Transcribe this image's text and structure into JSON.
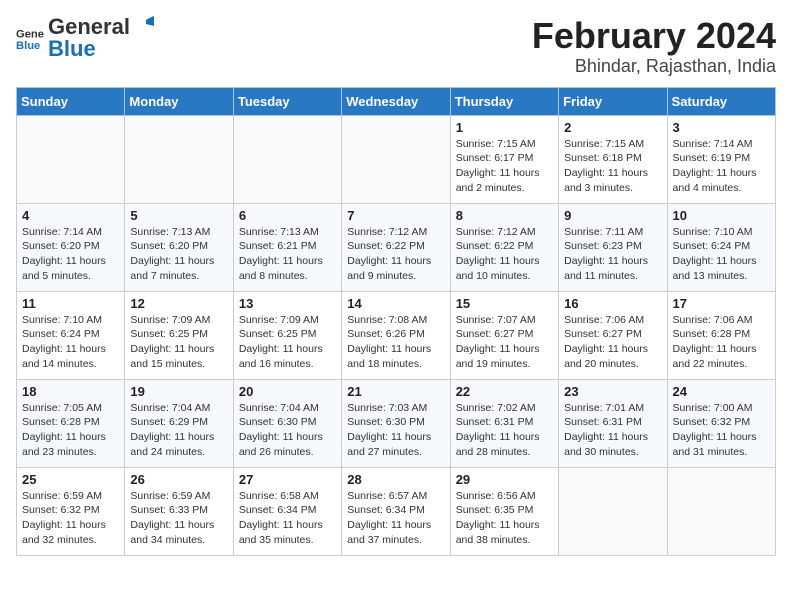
{
  "logo": {
    "text_general": "General",
    "text_blue": "Blue"
  },
  "title": "February 2024",
  "subtitle": "Bhindar, Rajasthan, India",
  "days_of_week": [
    "Sunday",
    "Monday",
    "Tuesday",
    "Wednesday",
    "Thursday",
    "Friday",
    "Saturday"
  ],
  "weeks": [
    [
      {
        "day": "",
        "info": ""
      },
      {
        "day": "",
        "info": ""
      },
      {
        "day": "",
        "info": ""
      },
      {
        "day": "",
        "info": ""
      },
      {
        "day": "1",
        "info": "Sunrise: 7:15 AM\nSunset: 6:17 PM\nDaylight: 11 hours and 2 minutes."
      },
      {
        "day": "2",
        "info": "Sunrise: 7:15 AM\nSunset: 6:18 PM\nDaylight: 11 hours and 3 minutes."
      },
      {
        "day": "3",
        "info": "Sunrise: 7:14 AM\nSunset: 6:19 PM\nDaylight: 11 hours and 4 minutes."
      }
    ],
    [
      {
        "day": "4",
        "info": "Sunrise: 7:14 AM\nSunset: 6:20 PM\nDaylight: 11 hours and 5 minutes."
      },
      {
        "day": "5",
        "info": "Sunrise: 7:13 AM\nSunset: 6:20 PM\nDaylight: 11 hours and 7 minutes."
      },
      {
        "day": "6",
        "info": "Sunrise: 7:13 AM\nSunset: 6:21 PM\nDaylight: 11 hours and 8 minutes."
      },
      {
        "day": "7",
        "info": "Sunrise: 7:12 AM\nSunset: 6:22 PM\nDaylight: 11 hours and 9 minutes."
      },
      {
        "day": "8",
        "info": "Sunrise: 7:12 AM\nSunset: 6:22 PM\nDaylight: 11 hours and 10 minutes."
      },
      {
        "day": "9",
        "info": "Sunrise: 7:11 AM\nSunset: 6:23 PM\nDaylight: 11 hours and 11 minutes."
      },
      {
        "day": "10",
        "info": "Sunrise: 7:10 AM\nSunset: 6:24 PM\nDaylight: 11 hours and 13 minutes."
      }
    ],
    [
      {
        "day": "11",
        "info": "Sunrise: 7:10 AM\nSunset: 6:24 PM\nDaylight: 11 hours and 14 minutes."
      },
      {
        "day": "12",
        "info": "Sunrise: 7:09 AM\nSunset: 6:25 PM\nDaylight: 11 hours and 15 minutes."
      },
      {
        "day": "13",
        "info": "Sunrise: 7:09 AM\nSunset: 6:25 PM\nDaylight: 11 hours and 16 minutes."
      },
      {
        "day": "14",
        "info": "Sunrise: 7:08 AM\nSunset: 6:26 PM\nDaylight: 11 hours and 18 minutes."
      },
      {
        "day": "15",
        "info": "Sunrise: 7:07 AM\nSunset: 6:27 PM\nDaylight: 11 hours and 19 minutes."
      },
      {
        "day": "16",
        "info": "Sunrise: 7:06 AM\nSunset: 6:27 PM\nDaylight: 11 hours and 20 minutes."
      },
      {
        "day": "17",
        "info": "Sunrise: 7:06 AM\nSunset: 6:28 PM\nDaylight: 11 hours and 22 minutes."
      }
    ],
    [
      {
        "day": "18",
        "info": "Sunrise: 7:05 AM\nSunset: 6:28 PM\nDaylight: 11 hours and 23 minutes."
      },
      {
        "day": "19",
        "info": "Sunrise: 7:04 AM\nSunset: 6:29 PM\nDaylight: 11 hours and 24 minutes."
      },
      {
        "day": "20",
        "info": "Sunrise: 7:04 AM\nSunset: 6:30 PM\nDaylight: 11 hours and 26 minutes."
      },
      {
        "day": "21",
        "info": "Sunrise: 7:03 AM\nSunset: 6:30 PM\nDaylight: 11 hours and 27 minutes."
      },
      {
        "day": "22",
        "info": "Sunrise: 7:02 AM\nSunset: 6:31 PM\nDaylight: 11 hours and 28 minutes."
      },
      {
        "day": "23",
        "info": "Sunrise: 7:01 AM\nSunset: 6:31 PM\nDaylight: 11 hours and 30 minutes."
      },
      {
        "day": "24",
        "info": "Sunrise: 7:00 AM\nSunset: 6:32 PM\nDaylight: 11 hours and 31 minutes."
      }
    ],
    [
      {
        "day": "25",
        "info": "Sunrise: 6:59 AM\nSunset: 6:32 PM\nDaylight: 11 hours and 32 minutes."
      },
      {
        "day": "26",
        "info": "Sunrise: 6:59 AM\nSunset: 6:33 PM\nDaylight: 11 hours and 34 minutes."
      },
      {
        "day": "27",
        "info": "Sunrise: 6:58 AM\nSunset: 6:34 PM\nDaylight: 11 hours and 35 minutes."
      },
      {
        "day": "28",
        "info": "Sunrise: 6:57 AM\nSunset: 6:34 PM\nDaylight: 11 hours and 37 minutes."
      },
      {
        "day": "29",
        "info": "Sunrise: 6:56 AM\nSunset: 6:35 PM\nDaylight: 11 hours and 38 minutes."
      },
      {
        "day": "",
        "info": ""
      },
      {
        "day": "",
        "info": ""
      }
    ]
  ]
}
